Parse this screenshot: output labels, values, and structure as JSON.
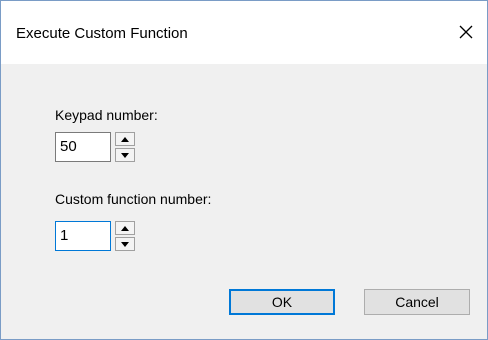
{
  "dialog": {
    "title": "Execute Custom Function",
    "keypad_label": "Keypad number:",
    "keypad_value": "50",
    "function_label": "Custom function number:",
    "function_value": "1",
    "ok_label": "OK",
    "cancel_label": "Cancel"
  },
  "colors": {
    "accent": "#0078d7",
    "window_border": "#7a9cc6",
    "client_bg": "#f0f0f0",
    "button_bg": "#e1e1e1"
  },
  "icons": {
    "close": "close-icon",
    "up": "spin-up-icon",
    "down": "spin-down-icon"
  }
}
